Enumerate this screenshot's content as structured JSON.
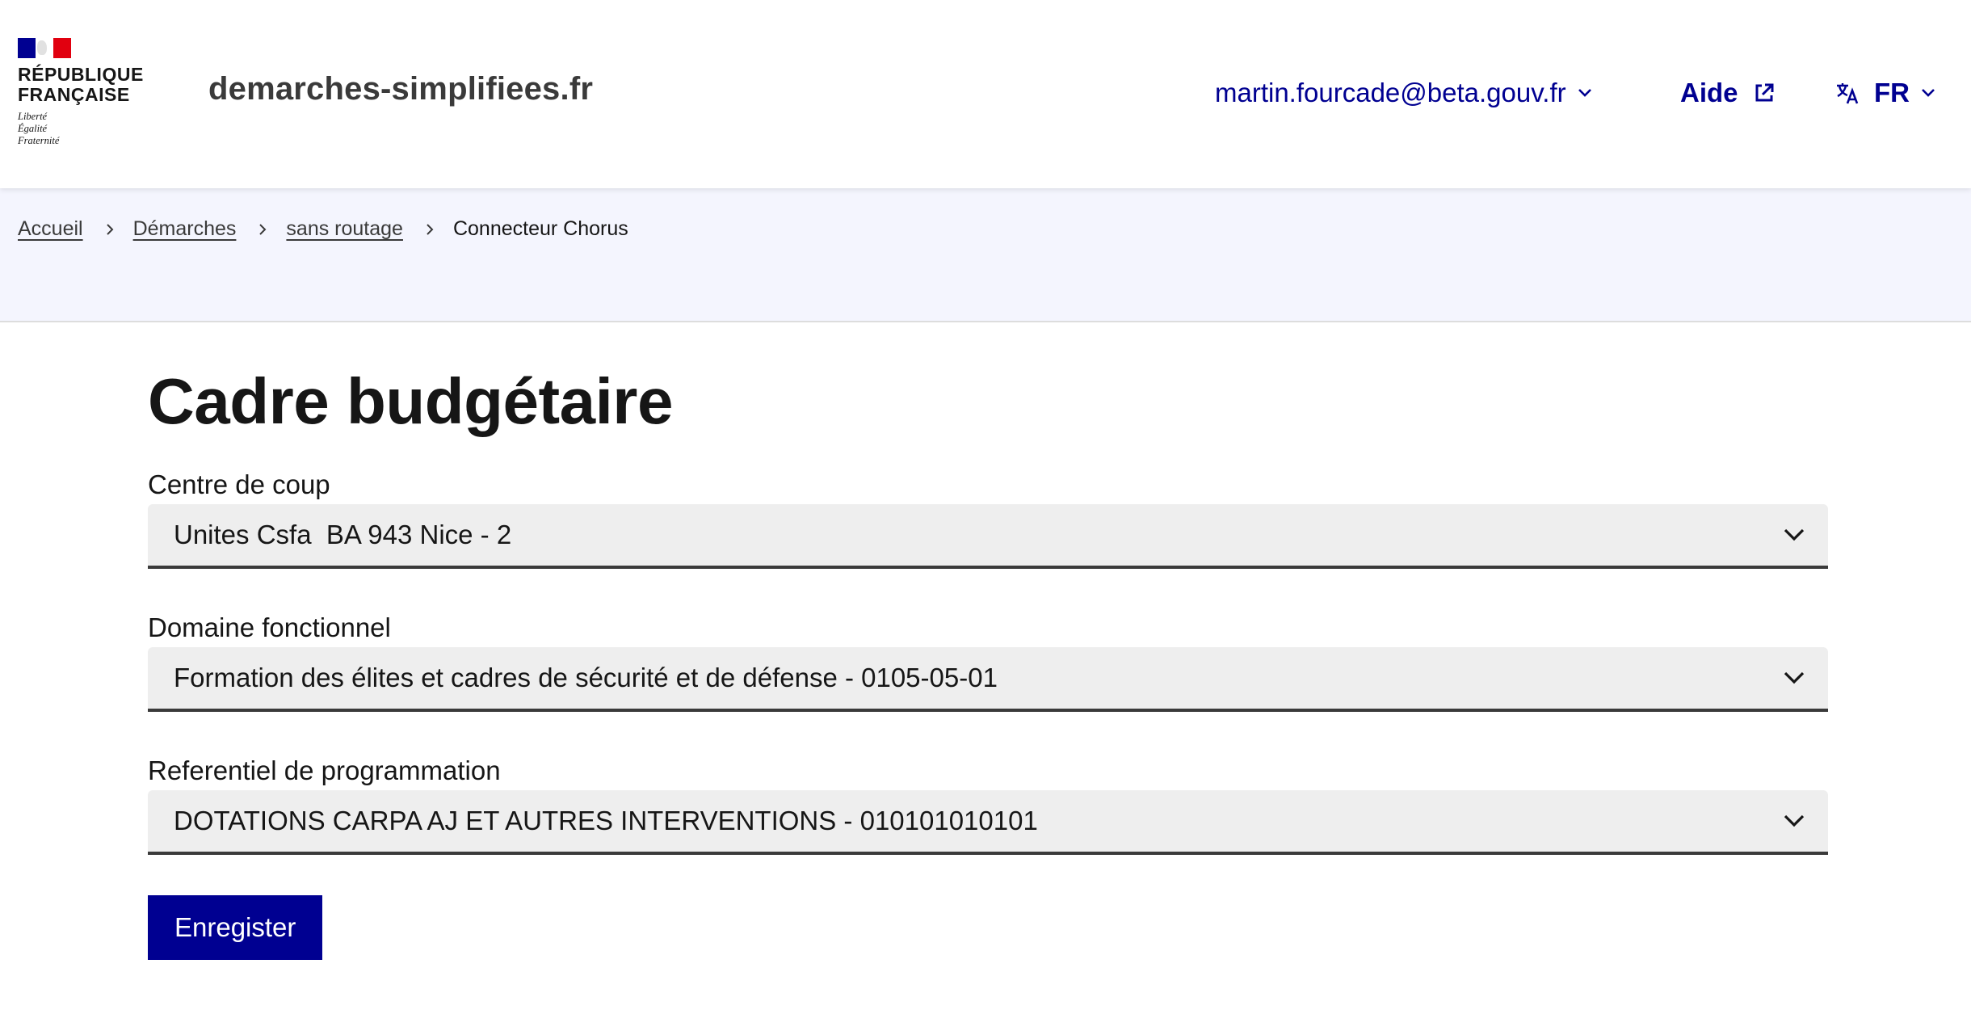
{
  "header": {
    "gov_name_line1": "RÉPUBLIQUE",
    "gov_name_line2": "FRANÇAISE",
    "motto_line1": "Liberté",
    "motto_line2": "Égalité",
    "motto_line3": "Fraternité",
    "site_name": "demarches-simplifiees.fr",
    "user_email": "martin.fourcade@beta.gouv.fr",
    "help_label": "Aide",
    "lang_label": "FR",
    "colors": {
      "accent": "#000091",
      "flag_blue": "#000091",
      "flag_red": "#e1000f"
    },
    "icons": {
      "user_menu": "chevron-down-icon",
      "help": "external-link-icon",
      "lang": "translate-icon"
    }
  },
  "breadcrumb": {
    "items": [
      {
        "label": "Accueil"
      },
      {
        "label": "Démarches"
      },
      {
        "label": "sans routage"
      }
    ],
    "current": "Connecteur Chorus"
  },
  "main": {
    "title": "Cadre budgétaire",
    "fields": [
      {
        "label": "Centre de coup",
        "value": "Unites Csfa  BA 943 Nice - 2"
      },
      {
        "label": "Domaine fonctionnel",
        "value": "Formation des élites et cadres de sécurité et de défense - 0105-05-01"
      },
      {
        "label": "Referentiel de programmation",
        "value": "DOTATIONS CARPA AJ ET AUTRES INTERVENTIONS - 010101010101"
      }
    ],
    "save_label": "Enregister"
  }
}
